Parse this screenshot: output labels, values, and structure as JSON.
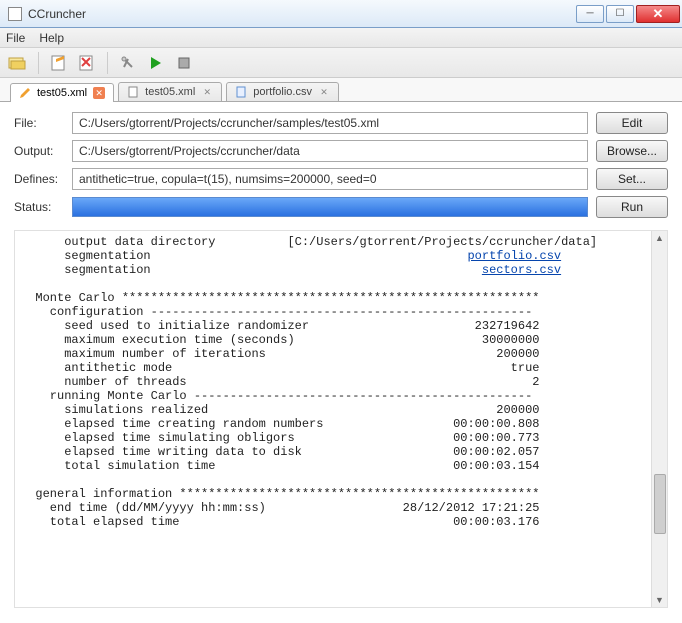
{
  "window": {
    "title": "CCruncher"
  },
  "menu": {
    "file": "File",
    "help": "Help"
  },
  "tabs": [
    {
      "label": "test05.xml",
      "active": true
    },
    {
      "label": "test05.xml",
      "active": false
    },
    {
      "label": "portfolio.csv",
      "active": false
    }
  ],
  "form": {
    "file_label": "File:",
    "file_value": "C:/Users/gtorrent/Projects/ccruncher/samples/test05.xml",
    "edit_btn": "Edit",
    "output_label": "Output:",
    "output_value": "C:/Users/gtorrent/Projects/ccruncher/data",
    "browse_btn": "Browse...",
    "defines_label": "Defines:",
    "defines_value": "antithetic=true, copula=t(15), numsims=200000, seed=0",
    "set_btn": "Set...",
    "status_label": "Status:",
    "run_btn": "Run"
  },
  "console": {
    "l01": "      output data directory          [C:/Users/gtorrent/Projects/ccruncher/data]",
    "l02a": "      segmentation                                            ",
    "l02b": "portfolio.csv",
    "l03a": "      segmentation                                              ",
    "l03b": "sectors.csv",
    "l04": "",
    "l05": "  Monte Carlo **********************************************************",
    "l06": "    configuration -----------------------------------------------------",
    "l07": "      seed used to initialize randomizer                       232719642",
    "l08": "      maximum execution time (seconds)                          30000000",
    "l09": "      maximum number of iterations                                200000",
    "l10": "      antithetic mode                                               true",
    "l11": "      number of threads                                                2",
    "l12": "    running Monte Carlo -----------------------------------------------",
    "l13": "      simulations realized                                        200000",
    "l14": "      elapsed time creating random numbers                  00:00:00.808",
    "l15": "      elapsed time simulating obligors                      00:00:00.773",
    "l16": "      elapsed time writing data to disk                     00:00:02.057",
    "l17": "      total simulation time                                 00:00:03.154",
    "l18": "",
    "l19": "  general information **************************************************",
    "l20": "    end time (dd/MM/yyyy hh:mm:ss)                   28/12/2012 17:21:25",
    "l21": "    total elapsed time                                      00:00:03.176"
  }
}
